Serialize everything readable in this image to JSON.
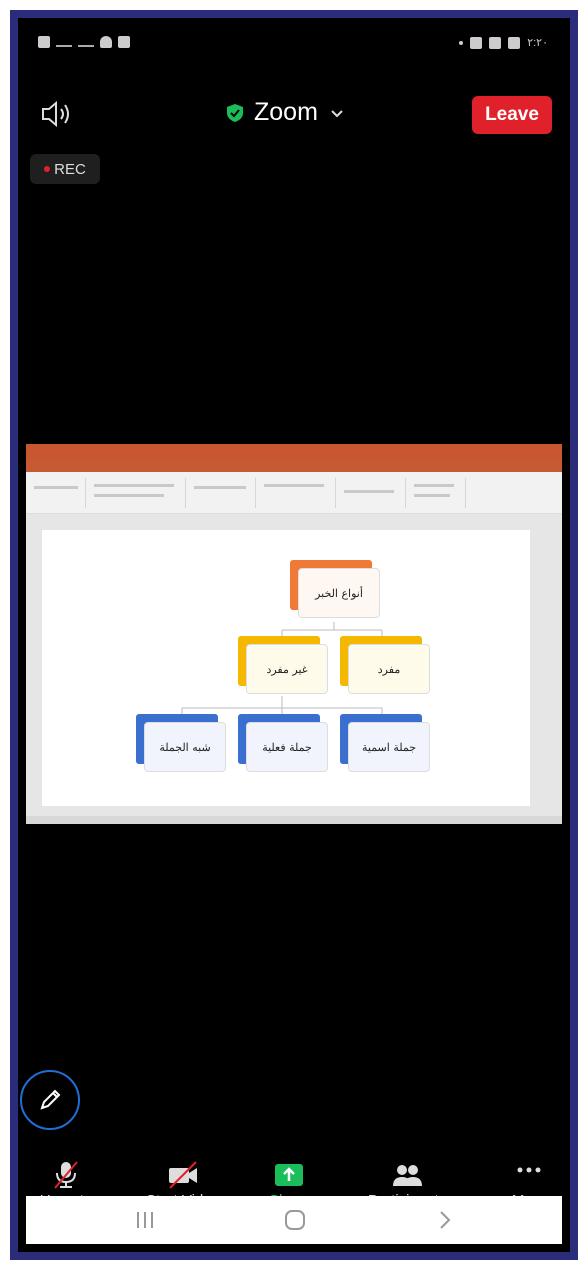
{
  "status_bar": {
    "time": "۲:۲۰"
  },
  "header": {
    "title": "Zoom",
    "leave_label": "Leave"
  },
  "rec_label": "REC",
  "shared_screen": {
    "diagram": {
      "root": "أنواع الخبر",
      "level2": [
        "مفرد",
        "غير مفرد"
      ],
      "level3": [
        "جملة اسمية",
        "جملة فعلية",
        "شبه الجملة"
      ]
    },
    "colors": {
      "root": "#ef7a37",
      "level2": "#f5b800",
      "level3": "#3a6fd0"
    }
  },
  "toolbar": {
    "items": [
      {
        "label": "Unmute",
        "icon": "microphone-muted-icon"
      },
      {
        "label": "Start Video",
        "icon": "video-off-icon"
      },
      {
        "label": "Share",
        "icon": "share-screen-icon"
      },
      {
        "label": "Participants",
        "icon": "participants-icon"
      },
      {
        "label": "More",
        "icon": "more-dots-icon"
      }
    ]
  },
  "navbar": {
    "icons": [
      "recent-apps-icon",
      "home-icon",
      "back-icon"
    ]
  },
  "colors": {
    "leave": "#e0212b",
    "share_green": "#1bbd5a",
    "frame": "#2b2c7a"
  }
}
